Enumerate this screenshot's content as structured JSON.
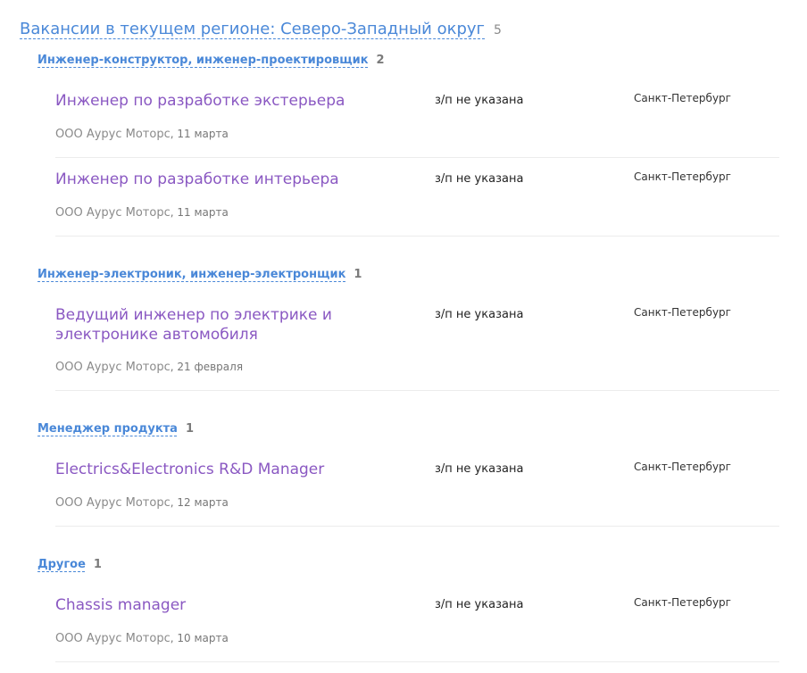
{
  "region": {
    "title": "Вакансии в текущем регионе: Северо-Западный округ",
    "count": "5"
  },
  "groups": [
    {
      "title": "Инженер-конструктор, инженер-проектировщик",
      "count": "2",
      "vacancies": [
        {
          "title": "Инженер по разработке экстерьера",
          "salary": "з/п не указана",
          "city": "Санкт-Петербург",
          "company": "ООО Аурус Моторс",
          "date": ", 11 марта"
        },
        {
          "title": "Инженер по разработке интерьера",
          "salary": "з/п не указана",
          "city": "Санкт-Петербург",
          "company": "ООО Аурус Моторс",
          "date": ", 11 марта"
        }
      ]
    },
    {
      "title": "Инженер-электроник, инженер-электронщик",
      "count": "1",
      "vacancies": [
        {
          "title": "Ведущий инженер по электрике и электронике автомобиля",
          "salary": "з/п не указана",
          "city": "Санкт-Петербург",
          "company": "ООО Аурус Моторс",
          "date": ", 21 февраля"
        }
      ]
    },
    {
      "title": "Менеджер продукта",
      "count": "1",
      "vacancies": [
        {
          "title": "Electrics&Electronics R&D Manager",
          "salary": "з/п не указана",
          "city": "Санкт-Петербург",
          "company": "ООО Аурус Моторс",
          "date": ", 12 марта"
        }
      ]
    },
    {
      "title": "Другое",
      "count": "1",
      "vacancies": [
        {
          "title": "Chassis manager",
          "salary": "з/п не указана",
          "city": "Санкт-Петербург",
          "company": "ООО Аурус Моторс",
          "date": ", 10 марта"
        }
      ]
    }
  ]
}
